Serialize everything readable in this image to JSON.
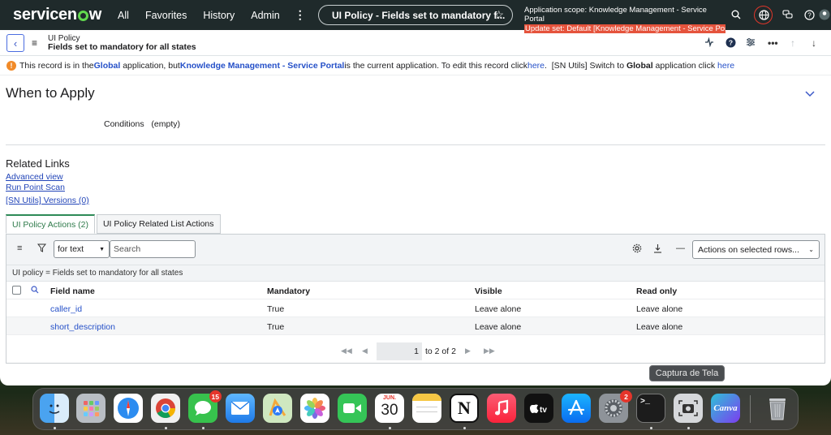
{
  "nav": {
    "logo": "servicenow",
    "links": [
      "All",
      "Favorites",
      "History",
      "Admin"
    ],
    "pill_title": "UI Policy - Fields set to mandatory f...",
    "scope_line": "Application scope: Knowledge Management - Service Portal",
    "update_set": "Update set: Default [Knowledge Management - Service Por..."
  },
  "header": {
    "type": "UI Policy",
    "title": "Fields set to mandatory for all states"
  },
  "banner": {
    "p1": "This record is in the ",
    "global1": "Global",
    "p2": " application, but ",
    "app": "Knowledge Management - Service Portal",
    "p3": " is the current application. To edit this record click ",
    "here1": "here",
    "p4": ".  [SN Utils] Switch to ",
    "global2": "Global",
    "p5": " application click ",
    "here2": "here"
  },
  "when_to_apply": {
    "title": "When to Apply",
    "conditions_label": "Conditions",
    "conditions_value": "(empty)"
  },
  "related_links": {
    "title": "Related Links",
    "items": [
      "Advanced view",
      "Run Point Scan",
      "[SN Utils] Versions (0)"
    ]
  },
  "tabs": [
    "UI Policy Actions (2)",
    "UI Policy Related List Actions"
  ],
  "list": {
    "filter_select": "for text",
    "search_placeholder": "Search",
    "actions_select": "Actions on selected rows...",
    "breadcrumb": "UI policy = Fields set to mandatory for all states",
    "columns": [
      "Field name",
      "Mandatory",
      "Visible",
      "Read only"
    ],
    "rows": [
      [
        "caller_id",
        "True",
        "Leave alone",
        "Leave alone"
      ],
      [
        "short_description",
        "True",
        "Leave alone",
        "Leave alone"
      ]
    ],
    "page": "1",
    "page_text": "to 2 of 2"
  },
  "tooltip": "Captura de Tela",
  "dock": {
    "calendar_month": "JUN.",
    "calendar_day": "30",
    "badges": {
      "messages": "15",
      "settings": "2"
    },
    "canva_label": "Canva"
  }
}
